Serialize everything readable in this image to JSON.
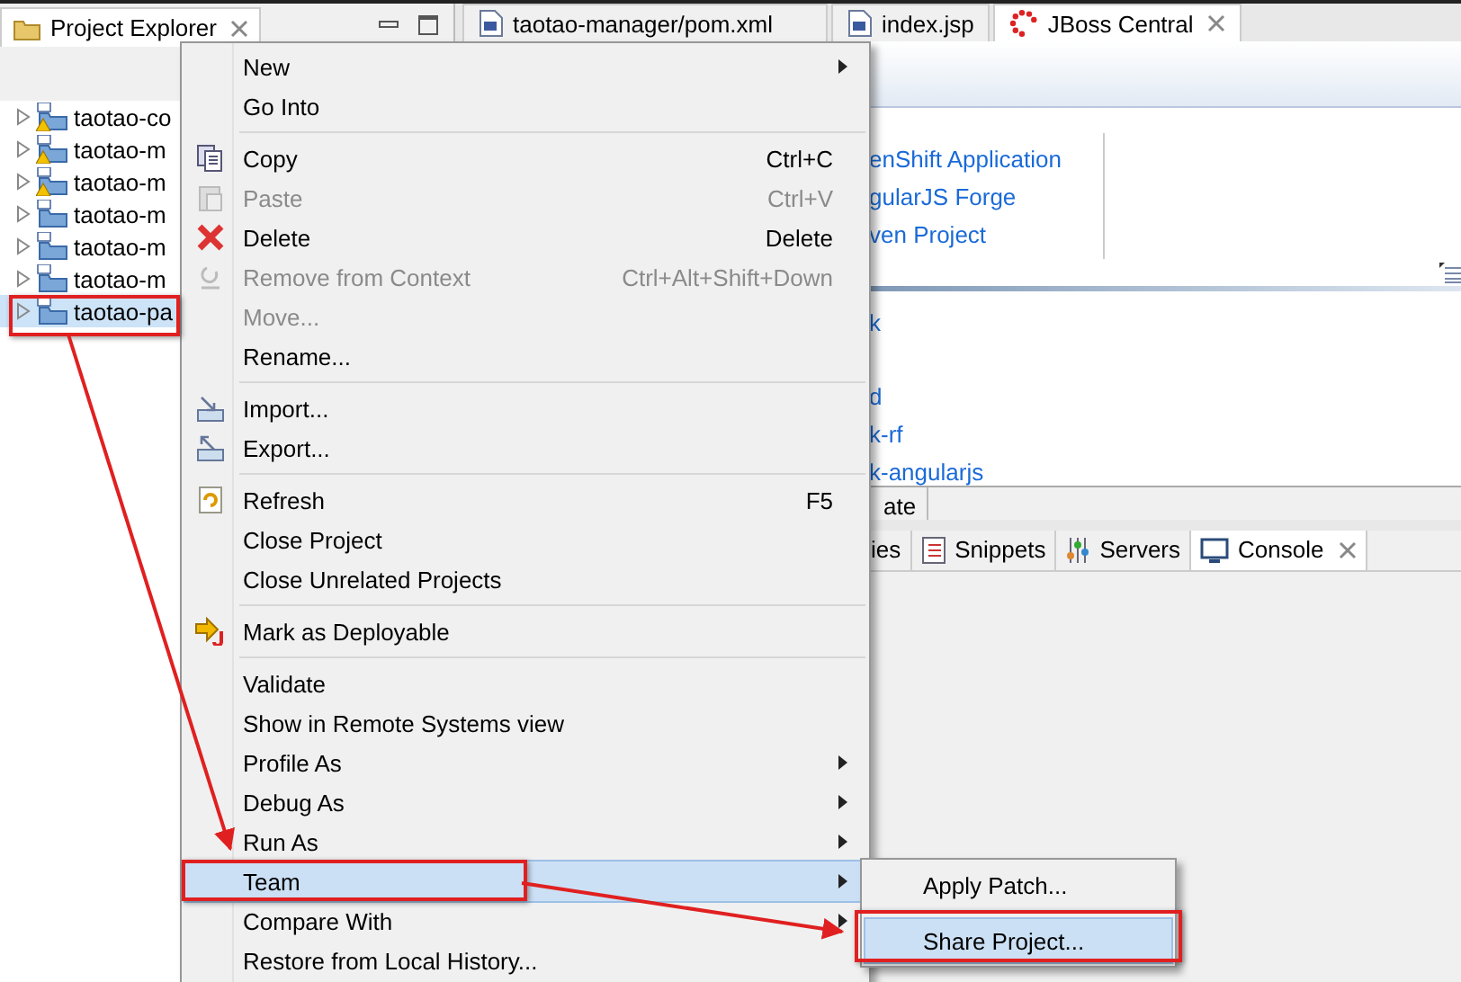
{
  "explorer": {
    "title": "Project Explorer",
    "items": [
      {
        "label": "taotao-co",
        "warning": true,
        "selected": false
      },
      {
        "label": "taotao-m",
        "warning": true,
        "selected": false
      },
      {
        "label": "taotao-m",
        "warning": true,
        "selected": false
      },
      {
        "label": "taotao-m",
        "warning": false,
        "selected": false
      },
      {
        "label": "taotao-m",
        "warning": false,
        "selected": false
      },
      {
        "label": "taotao-m",
        "warning": false,
        "selected": false
      },
      {
        "label": "taotao-pa",
        "warning": false,
        "selected": true
      }
    ]
  },
  "editor_tabs": [
    {
      "label": "taotao-manager/pom.xml",
      "selected": false,
      "closable": false
    },
    {
      "label": "index.jsp",
      "selected": false,
      "closable": false
    },
    {
      "label": "JBoss Central",
      "selected": true,
      "closable": true
    }
  ],
  "central": {
    "links_top": [
      "enShift Application",
      "gularJS Forge",
      "ven Project"
    ],
    "links_bottom": [
      "k",
      "d",
      "k-rf",
      "k-angularjs"
    ],
    "tab": "ate"
  },
  "bottom_tabs": [
    {
      "label": "ies",
      "selected": false,
      "closable": false
    },
    {
      "label": "Snippets",
      "selected": false,
      "closable": false
    },
    {
      "label": "Servers",
      "selected": false,
      "closable": false
    },
    {
      "label": "Console",
      "selected": true,
      "closable": true
    }
  ],
  "context_menu": [
    {
      "kind": "item",
      "label": "New",
      "submenu": true,
      "disabled": false,
      "selected": false
    },
    {
      "kind": "item",
      "label": "Go Into",
      "disabled": false,
      "selected": false
    },
    {
      "kind": "separator"
    },
    {
      "kind": "item",
      "label": "Copy",
      "shortcut": "Ctrl+C",
      "disabled": false,
      "selected": false
    },
    {
      "kind": "item",
      "label": "Paste",
      "shortcut": "Ctrl+V",
      "disabled": true,
      "selected": false
    },
    {
      "kind": "item",
      "label": "Delete",
      "shortcut": "Delete",
      "disabled": false,
      "selected": false
    },
    {
      "kind": "item",
      "label": "Remove from Context",
      "shortcut": "Ctrl+Alt+Shift+Down",
      "disabled": true,
      "selected": false
    },
    {
      "kind": "item",
      "label": "Move...",
      "disabled": true,
      "selected": false
    },
    {
      "kind": "item",
      "label": "Rename...",
      "disabled": false,
      "selected": false
    },
    {
      "kind": "separator"
    },
    {
      "kind": "item",
      "label": "Import...",
      "disabled": false,
      "selected": false
    },
    {
      "kind": "item",
      "label": "Export...",
      "disabled": false,
      "selected": false
    },
    {
      "kind": "separator"
    },
    {
      "kind": "item",
      "label": "Refresh",
      "shortcut": "F5",
      "disabled": false,
      "selected": false
    },
    {
      "kind": "item",
      "label": "Close Project",
      "disabled": false,
      "selected": false
    },
    {
      "kind": "item",
      "label": "Close Unrelated Projects",
      "disabled": false,
      "selected": false
    },
    {
      "kind": "separator"
    },
    {
      "kind": "item",
      "label": "Mark as Deployable",
      "disabled": false,
      "selected": false
    },
    {
      "kind": "separator"
    },
    {
      "kind": "item",
      "label": "Validate",
      "disabled": false,
      "selected": false
    },
    {
      "kind": "item",
      "label": "Show in Remote Systems view",
      "disabled": false,
      "selected": false
    },
    {
      "kind": "item",
      "label": "Profile As",
      "submenu": true,
      "disabled": false,
      "selected": false
    },
    {
      "kind": "item",
      "label": "Debug As",
      "submenu": true,
      "disabled": false,
      "selected": false
    },
    {
      "kind": "item",
      "label": "Run As",
      "submenu": true,
      "disabled": false,
      "selected": false
    },
    {
      "kind": "item",
      "label": "Team",
      "submenu": true,
      "disabled": false,
      "selected": true
    },
    {
      "kind": "item",
      "label": "Compare With",
      "submenu": true,
      "disabled": false,
      "selected": false
    },
    {
      "kind": "item",
      "label": "Restore from Local History...",
      "disabled": false,
      "selected": false
    }
  ],
  "team_submenu": [
    {
      "kind": "item",
      "label": "Apply Patch...",
      "selected": false
    },
    {
      "kind": "separator"
    },
    {
      "kind": "item",
      "label": "Share Project...",
      "selected": true
    }
  ]
}
